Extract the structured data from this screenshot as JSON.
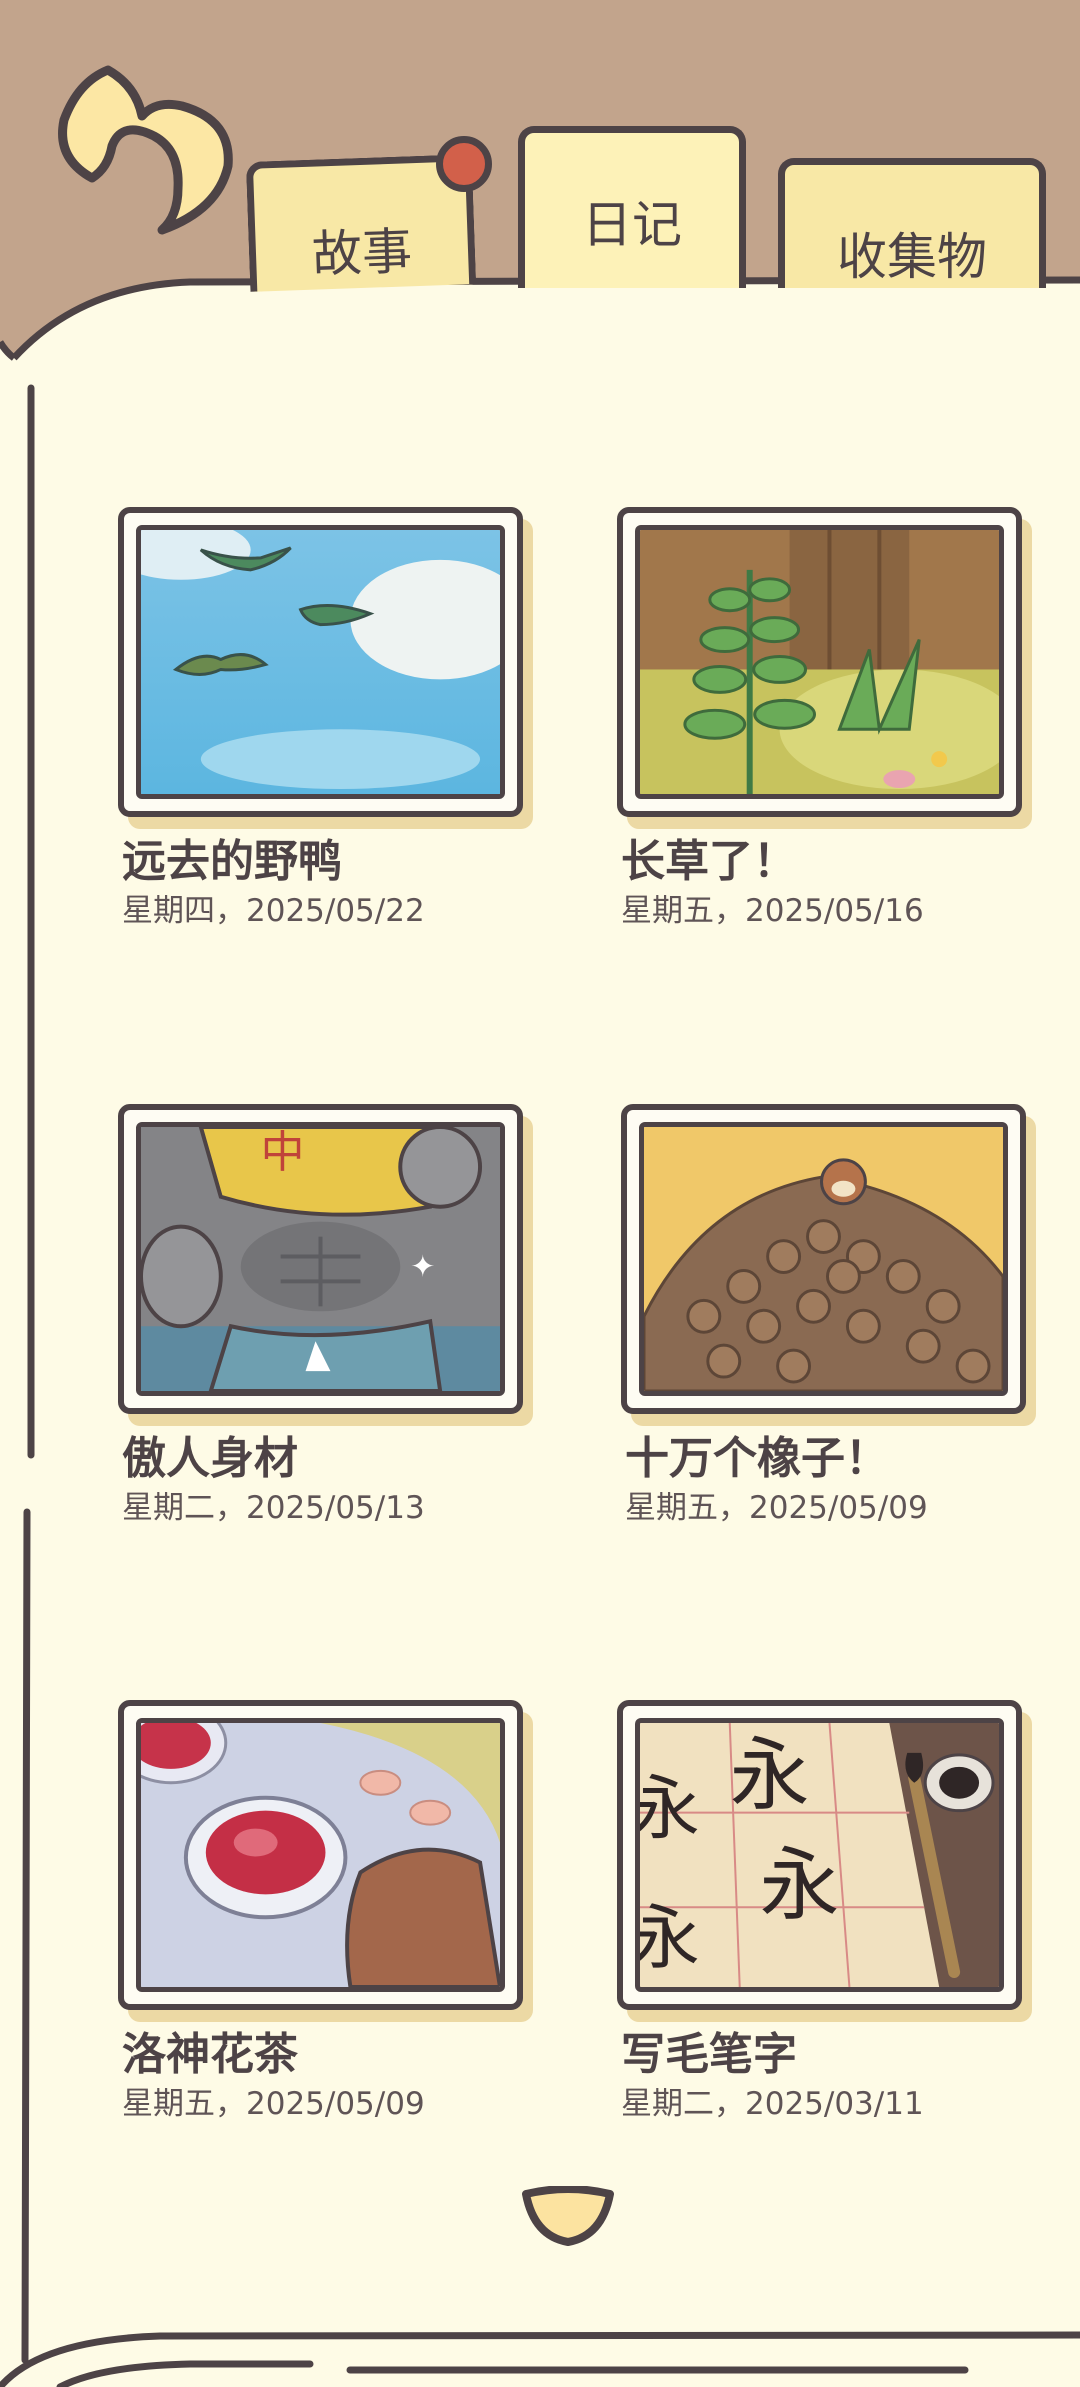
{
  "nav": {
    "back_icon": "back-arrow-icon",
    "tabs": [
      {
        "label": "故事",
        "selected": false,
        "has_notification": true
      },
      {
        "label": "日记",
        "selected": true,
        "has_notification": false
      },
      {
        "label": "收集物",
        "selected": false,
        "has_notification": false
      }
    ]
  },
  "entries": [
    {
      "title": "远去的野鸭",
      "date": "星期四，2025/05/22",
      "picture": "wild-ducks-flying-sky"
    },
    {
      "title": "长草了！",
      "date": "星期五，2025/05/16",
      "picture": "plants-growing-forest"
    },
    {
      "title": "傲人身材",
      "date": "星期二，2025/05/13",
      "picture": "frog-showing-abs"
    },
    {
      "title": "十万个橡子！",
      "date": "星期五，2025/05/09",
      "picture": "pile-of-acorns"
    },
    {
      "title": "洛神花茶",
      "date": "星期五，2025/05/09",
      "picture": "roselle-tea-cup"
    },
    {
      "title": "写毛笔字",
      "date": "星期二，2025/03/11",
      "picture": "calligraphy-brush-paper"
    }
  ],
  "pager": {
    "next_icon": "page-down-icon"
  },
  "colors": {
    "background": "#c2a48c",
    "page": "#fefbe6",
    "outline": "#4d4346",
    "tab": "#f8e8a6",
    "notification": "#d2604a"
  }
}
